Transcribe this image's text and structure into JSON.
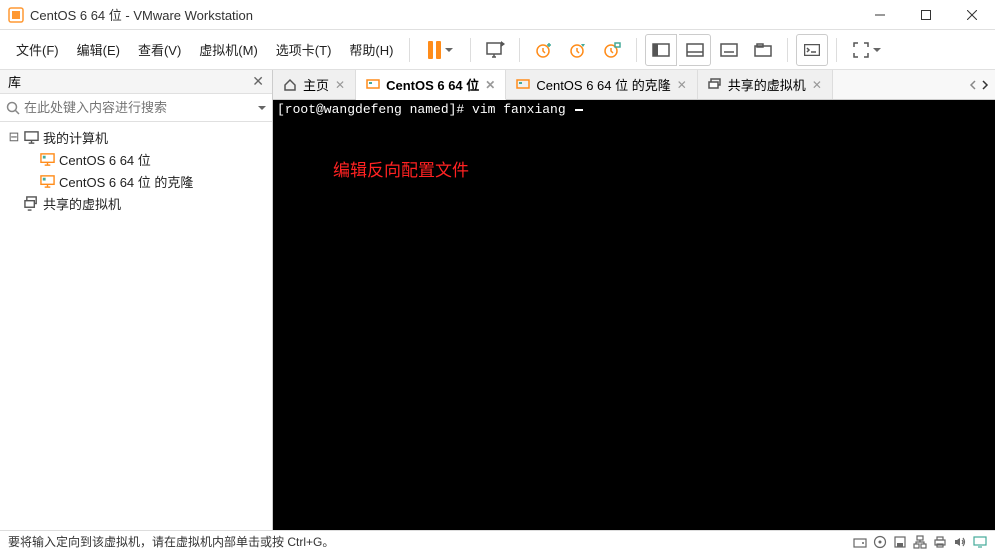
{
  "window": {
    "title": "CentOS 6 64 位 - VMware Workstation"
  },
  "menubar": {
    "file": "文件(F)",
    "edit": "编辑(E)",
    "view": "查看(V)",
    "vm": "虚拟机(M)",
    "tabs": "选项卡(T)",
    "help": "帮助(H)"
  },
  "sidebar": {
    "title": "库",
    "search_placeholder": "在此处键入内容进行搜索",
    "root": "我的计算机",
    "items": [
      "CentOS 6 64 位",
      "CentOS 6 64 位 的克隆"
    ],
    "shared": "共享的虚拟机"
  },
  "tabs": {
    "home": "主页",
    "t0": "CentOS 6 64 位",
    "t1": "CentOS 6 64 位 的克隆",
    "t2": "共享的虚拟机"
  },
  "terminal": {
    "prompt": "[root@wangdefeng named]# ",
    "command": "vim fanxiang ",
    "annotation": "编辑反向配置文件"
  },
  "statusbar": {
    "message": "要将输入定向到该虚拟机，请在虚拟机内部单击或按 Ctrl+G。"
  }
}
